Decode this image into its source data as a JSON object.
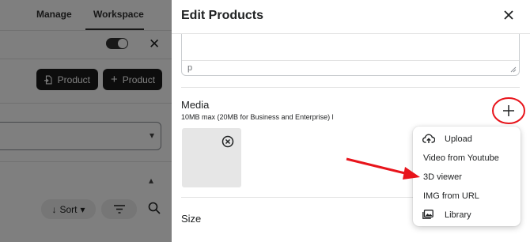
{
  "background": {
    "tabs": [
      "Manage",
      "Workspace"
    ],
    "buttons": [
      {
        "label": "Product",
        "icon": "import-product-icon"
      },
      {
        "label": "Product",
        "icon": "plus-icon"
      }
    ],
    "sort_label": "Sort"
  },
  "modal": {
    "title": "Edit Products",
    "editor_status": "p",
    "media": {
      "title": "Media",
      "subtitle": "10MB max (20MB for Business and Enterprise) l"
    },
    "size_title": "Size",
    "add_menu": [
      {
        "label": "Upload",
        "icon": "cloud-upload-icon"
      },
      {
        "label": "Video from Youtube",
        "icon": null
      },
      {
        "label": "3D viewer",
        "icon": null
      },
      {
        "label": "IMG from URL",
        "icon": null
      },
      {
        "label": "Library",
        "icon": "image-library-icon"
      }
    ]
  },
  "annotation": {
    "circle_color": "#e8141b",
    "arrow_color": "#e8141b",
    "arrow_target": "3D viewer"
  },
  "colors": {
    "dark_button": "#1a1a1a",
    "overlay": "rgba(0,0,0,0.5)"
  }
}
